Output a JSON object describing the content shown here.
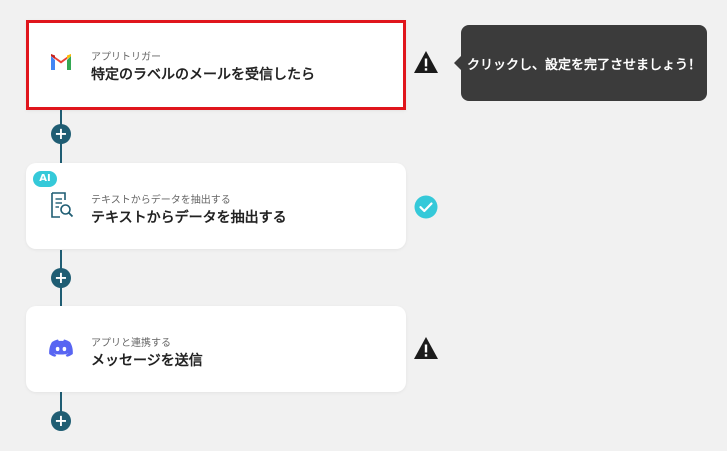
{
  "steps": [
    {
      "subtitle": "アプリトリガー",
      "title": "特定のラベルのメールを受信したら",
      "icon": "gmail-icon",
      "status": "warning-icon",
      "selected": true
    },
    {
      "subtitle": "テキストからデータを抽出する",
      "title": "テキストからデータを抽出する",
      "icon": "document-search-icon",
      "status": "check-icon",
      "badge": "AI"
    },
    {
      "subtitle": "アプリと連携する",
      "title": "メッセージを送信",
      "icon": "discord-icon",
      "status": "warning-icon"
    }
  ],
  "tooltip": {
    "text": "クリックし、設定を完了させましょう！"
  },
  "add_label": "+",
  "colors": {
    "connector": "#1f5d73",
    "selected_border": "#e0161d",
    "check": "#35c9d9",
    "discord": "#5865f2"
  }
}
